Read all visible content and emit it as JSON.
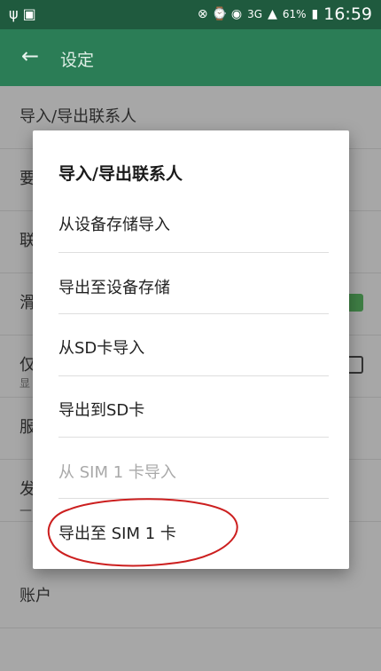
{
  "status_bar": {
    "left_icons": "ψ ▣",
    "signal": "3G",
    "battery": "61%",
    "time": "16:59"
  },
  "appbar": {
    "back_icon": "arrow-left-icon",
    "title": "设定"
  },
  "settings": [
    {
      "label": "导入/导出联系人"
    },
    {
      "label": "要"
    },
    {
      "label": "联"
    },
    {
      "label": "滑"
    },
    {
      "label": "仅",
      "sub": "显"
    },
    {
      "label": "服"
    },
    {
      "label": "发",
      "sub": "—"
    },
    {
      "label": "账户"
    }
  ],
  "dialog": {
    "title": "导入/导出联系人",
    "items": [
      {
        "label": "从设备存储导入"
      },
      {
        "label": "导出至设备存储"
      },
      {
        "label": "从SD卡导入"
      },
      {
        "label": "导出到SD卡"
      },
      {
        "label": "从 SIM 1 卡导入",
        "disabled": true
      },
      {
        "label": "导出至 SIM 1 卡"
      }
    ]
  },
  "colors": {
    "statusbar": "#1f5a3e",
    "appbar": "#2b7d56",
    "annotation": "#cc1f1f"
  }
}
